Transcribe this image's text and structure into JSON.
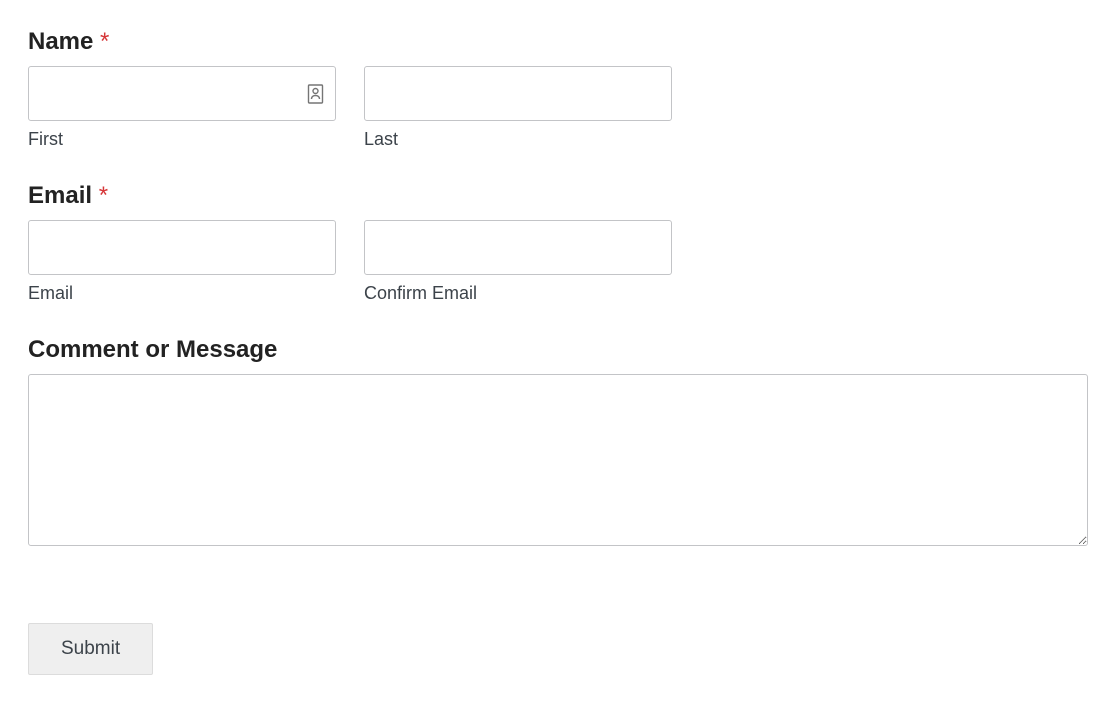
{
  "form": {
    "name": {
      "label": "Name",
      "required_marker": "*",
      "first_label": "First",
      "last_label": "Last",
      "first_value": "",
      "last_value": ""
    },
    "email": {
      "label": "Email",
      "required_marker": "*",
      "email_label": "Email",
      "confirm_label": "Confirm Email",
      "email_value": "",
      "confirm_value": ""
    },
    "comment": {
      "label": "Comment or Message",
      "value": ""
    },
    "submit_label": "Submit"
  }
}
